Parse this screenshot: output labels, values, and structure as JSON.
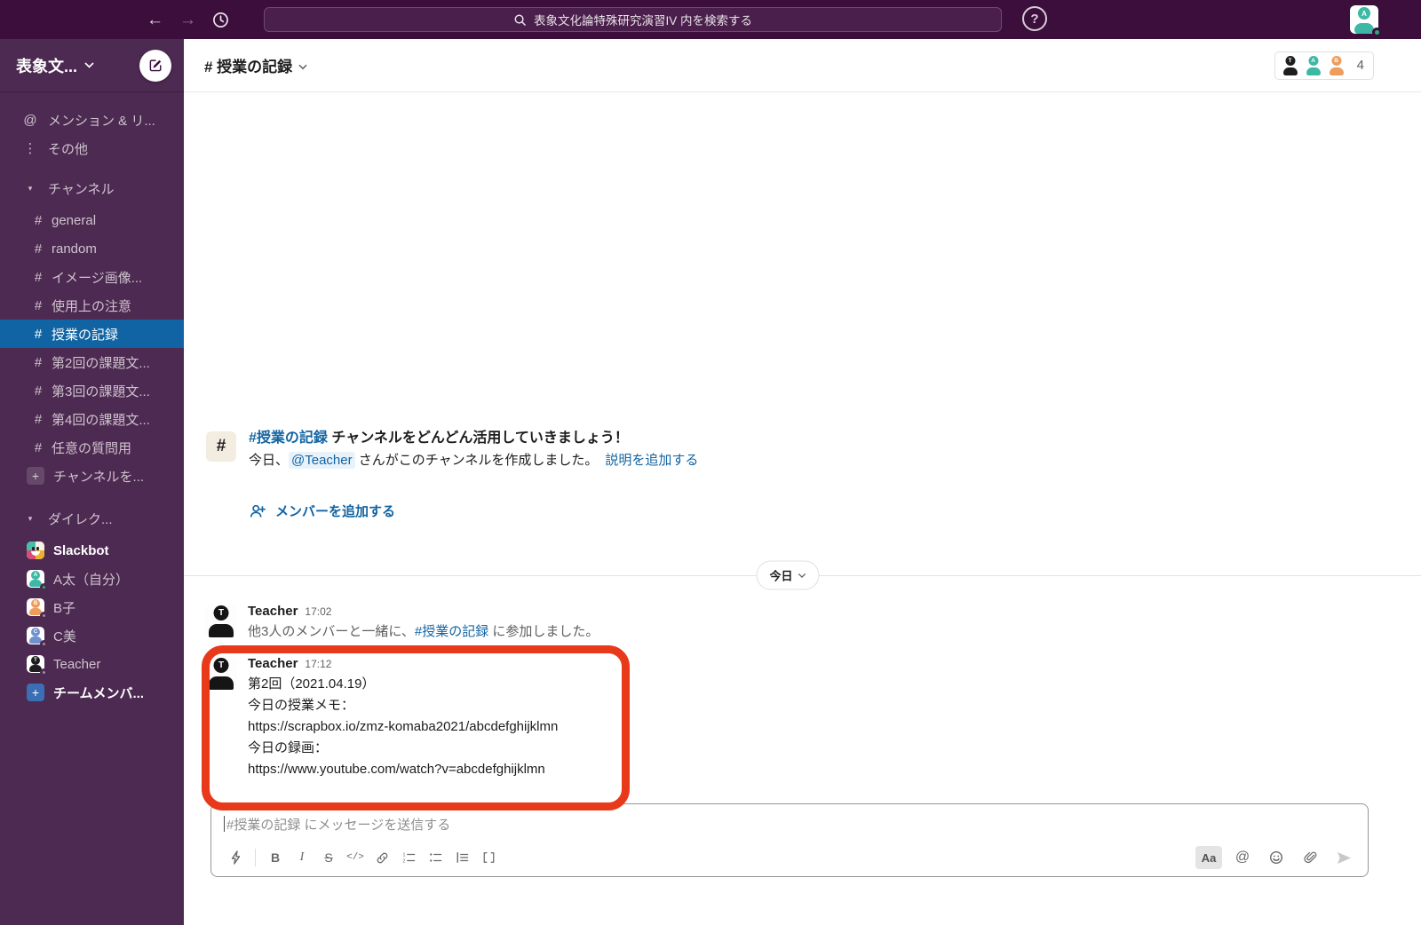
{
  "colors": {
    "topbar_bg": "#3b0e3c",
    "sidebar_bg": "#4d2a51",
    "selected_channel_bg": "#1164a3",
    "link_blue": "#1264a3",
    "highlight_red": "#e8391a",
    "online_green": "#2bac76",
    "avatar_teal": "#3db8a5",
    "avatar_orange": "#ee9d5c",
    "avatar_blue": "#7191ce",
    "avatar_black": "#1d1d1d"
  },
  "topbar": {
    "search_placeholder": "表象文化論特殊研究演習IV 内を検索する",
    "help_glyph": "?",
    "user_initial": "A"
  },
  "sidebar": {
    "workspace_name": "表象文...",
    "mentions_label": "メンション & リ...",
    "more_label": "その他",
    "channels_header": "チャンネル",
    "channels": [
      {
        "label": "general"
      },
      {
        "label": "random"
      },
      {
        "label": "イメージ画像..."
      },
      {
        "label": "使用上の注意"
      },
      {
        "label": "授業の記録"
      },
      {
        "label": "第2回の課題文..."
      },
      {
        "label": "第3回の課題文..."
      },
      {
        "label": "第4回の課題文..."
      },
      {
        "label": "任意の質問用"
      }
    ],
    "add_channel_label": "チャンネルを...",
    "dm_header": "ダイレク...",
    "dms": [
      {
        "label": "Slackbot"
      },
      {
        "label": "A太（自分）",
        "initial": "A"
      },
      {
        "label": "B子",
        "initial": "B"
      },
      {
        "label": "C美",
        "initial": "C"
      },
      {
        "label": "Teacher",
        "initial": "T"
      }
    ],
    "invite_label": "チームメンバ..."
  },
  "header": {
    "channel_title": "# 授業の記録",
    "member_count": "4",
    "member_initials": [
      "T",
      "A",
      "B"
    ]
  },
  "intro": {
    "hash_glyph": "#",
    "channel_link": "#授業の記録",
    "title_rest": " チャンネルをどんどん活用していきましょう！",
    "created_prefix": "今日、",
    "mention": "@Teacher",
    "created_suffix": " さんがこのチャンネルを作成しました。",
    "add_description": "説明を追加する",
    "add_member": "メンバーを追加する"
  },
  "timeline": {
    "date_label": "今日",
    "join_message": {
      "author": "Teacher",
      "time": "17:02",
      "author_initial": "T",
      "prefix": "他3人のメンバーと一緒に、",
      "channel_link": "#授業の記録",
      "suffix": " に参加しました。"
    },
    "post_message": {
      "author": "Teacher",
      "time": "17:12",
      "author_initial": "T",
      "lines": [
        "第2回（2021.04.19）",
        "今日の授業メモ：",
        "https://scrapbox.io/zmz-komaba2021/abcdefghijklmn",
        "今日の録画：",
        "https://www.youtube.com/watch?v=abcdefghijklmn"
      ]
    }
  },
  "composer": {
    "placeholder": "#授業の記録 にメッセージを送信する",
    "bold_label": "B",
    "italic_label": "I",
    "strike_label": "S",
    "code_label": "</>",
    "format_label": "Aa",
    "mention_label": "@"
  }
}
